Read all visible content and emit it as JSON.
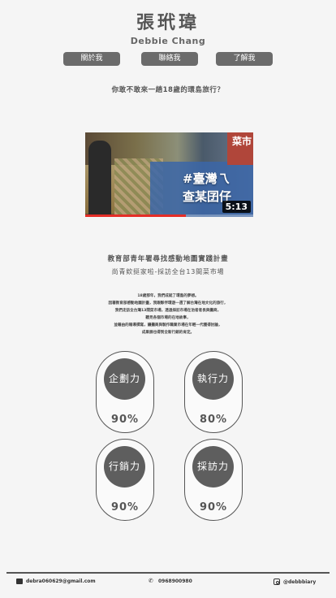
{
  "header": {
    "name_zh": "張玳瑋",
    "name_en": "Debbie Chang"
  },
  "nav": {
    "about": "關於我",
    "contact": "聯絡我",
    "more": "了解我"
  },
  "question": "你敢不敢來一趟18歲的環島旅行？",
  "video": {
    "title_line1": "#臺灣乁",
    "title_line2": "查某囝仔",
    "sign": "菜市",
    "duration": "5:13",
    "progress": 0.6
  },
  "project": {
    "title": "教育部青年署尋找感動地圖實踐計畫",
    "subtitle": "尚青欸挺家啦-採訪全台13間菜市場"
  },
  "description": [
    "18歲那年，我們成就了環島的夢想。",
    "因著教育部感動地圖計畫，我跟夥伴環遊一週了解台灣在地文化的旅行，",
    "我們走訪全台灣13間菜市場，透過採訪市場在治者者長與攤商，",
    "聽見各個市場的在地故事，",
    "並藉由的報導撰寫，讓攤商與製作職業市場在年輕一代獲得討論，",
    "成果展也得到全新行銷的肯定。"
  ],
  "skills": [
    {
      "label": "企劃力",
      "percent": "90%"
    },
    {
      "label": "執行力",
      "percent": "80%"
    },
    {
      "label": "行銷力",
      "percent": "90%"
    },
    {
      "label": "採訪力",
      "percent": "90%"
    }
  ],
  "footer": {
    "email": "debra060629@gmail.com",
    "phone": "0968900980",
    "instagram": "@debbbiary"
  },
  "colors": {
    "button": "#6b6b6b",
    "circle": "#5e5e5e",
    "background": "#f5f5f5",
    "progress": "#e52d27"
  }
}
